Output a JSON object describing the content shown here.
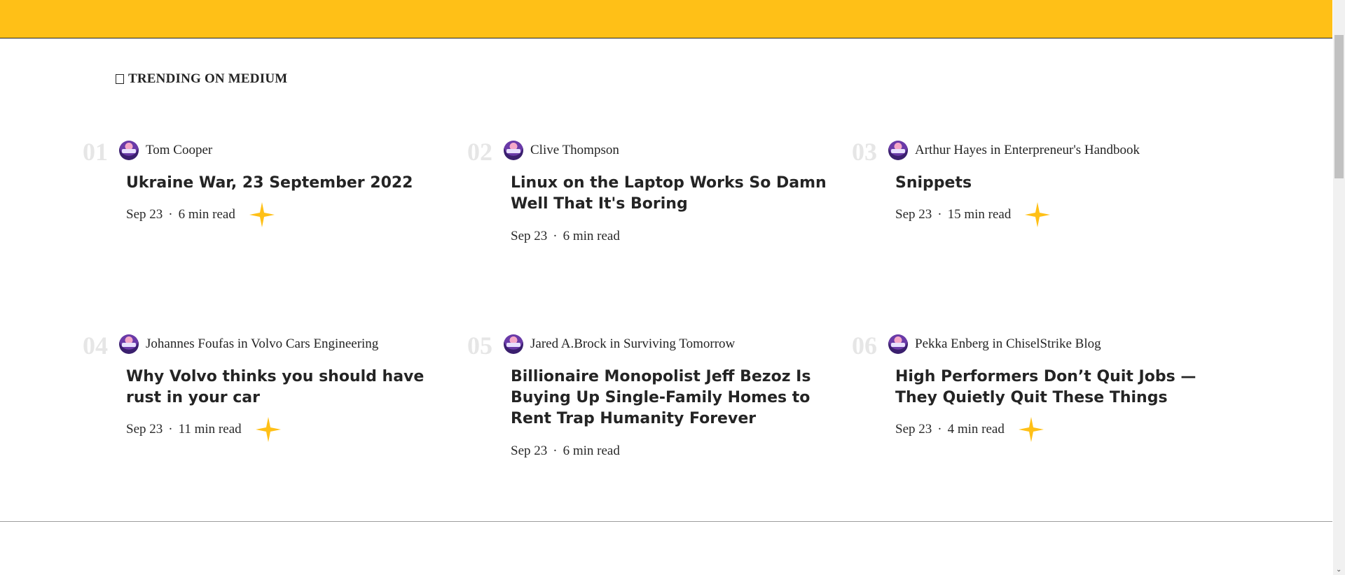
{
  "trending": {
    "label": "TRENDING ON MEDIUM"
  },
  "articles": [
    {
      "number": "01",
      "author": "Tom Cooper",
      "title": "Ukraine War, 23 September 2022",
      "date": "Sep 23",
      "read_time": "6 min read",
      "member_only": true
    },
    {
      "number": "02",
      "author": "Clive Thompson",
      "title": "Linux on the Laptop Works So Damn Well That It's Boring",
      "date": "Sep 23",
      "read_time": "6 min read",
      "member_only": false
    },
    {
      "number": "03",
      "author": "Arthur Hayes in Enterpreneur's Handbook",
      "title": "Snippets",
      "date": "Sep 23",
      "read_time": "15 min read",
      "member_only": true
    },
    {
      "number": "04",
      "author": "Johannes Foufas in Volvo Cars Engineering",
      "title": "Why Volvo thinks you should have rust in your car",
      "date": "Sep 23",
      "read_time": "11 min read",
      "member_only": true
    },
    {
      "number": "05",
      "author": "Jared A.Brock in Surviving Tomorrow",
      "title": "Billionaire Monopolist Jeff Bezoz Is Buying Up Single-Family Homes to Rent Trap Humanity Forever",
      "date": "Sep 23",
      "read_time": "6 min read",
      "member_only": false
    },
    {
      "number": "06",
      "author": "Pekka Enberg in ChiselStrike Blog",
      "title": "High Performers Don’t Quit Jobs — They Quietly Quit These Things",
      "date": "Sep 23",
      "read_time": "4 min read",
      "member_only": true
    }
  ],
  "meta_separator": "·",
  "colors": {
    "topbar": "#ffc017",
    "star": "#ffc017",
    "number": "#e6e6e6"
  },
  "icons": {
    "trending": "trending-icon",
    "member_only": "star-icon"
  }
}
